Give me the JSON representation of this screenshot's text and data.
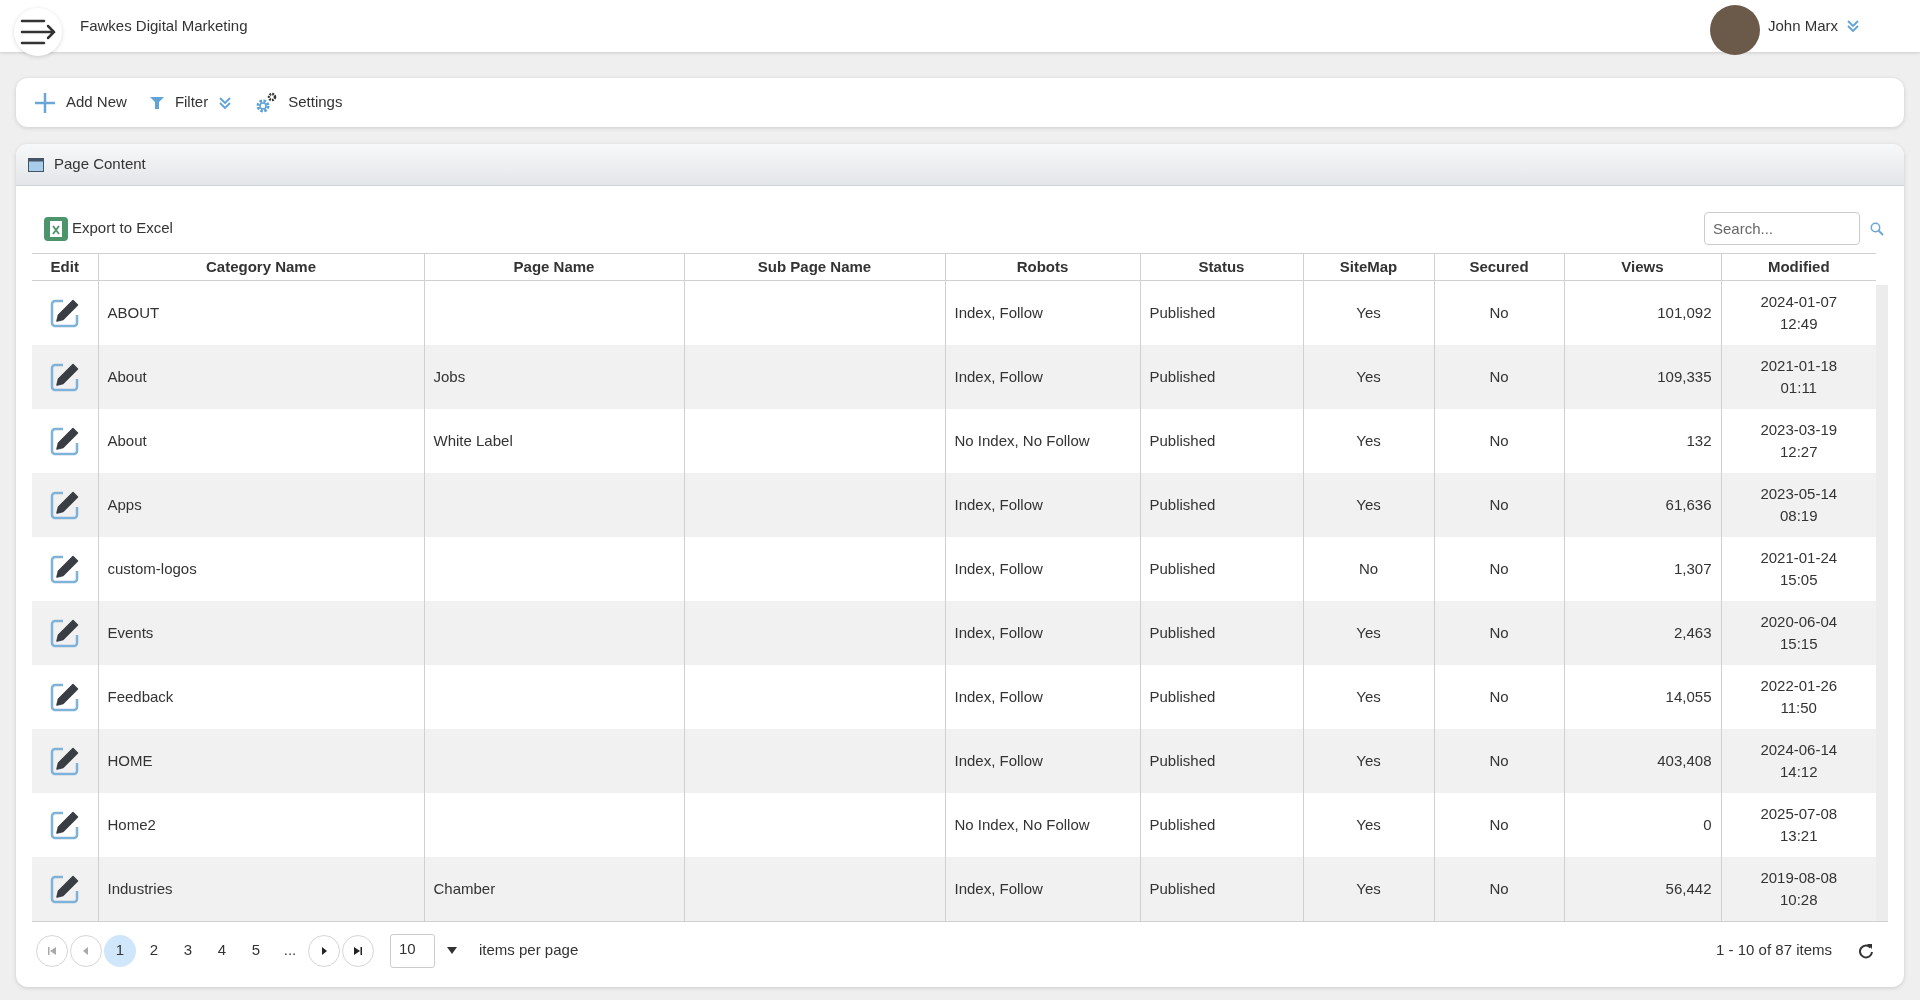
{
  "header": {
    "title": "Fawkes Digital Marketing",
    "user": "John Marx"
  },
  "toolbar": [
    {
      "kind": "add",
      "label": "Add New"
    },
    {
      "kind": "filter",
      "label": "Filter"
    },
    {
      "kind": "settings",
      "label": "Settings"
    }
  ],
  "panel": {
    "title": "Page Content",
    "export": "Export to Excel",
    "search": {
      "placeholder": "Search..."
    }
  },
  "table": {
    "columns": [
      "Edit",
      "Category Name",
      "Page Name",
      "Sub Page Name",
      "Robots",
      "Status",
      "SiteMap",
      "Secured",
      "Views",
      "Modified"
    ],
    "rows": [
      [
        "",
        "ABOUT",
        "",
        "",
        "Index, Follow",
        "Published",
        "Yes",
        "No",
        "101,092",
        "2024-01-07 12:49"
      ],
      [
        "",
        "About",
        "Jobs",
        "",
        "Index, Follow",
        "Published",
        "Yes",
        "No",
        "109,335",
        "2021-01-18 01:11"
      ],
      [
        "",
        "About",
        "White Label",
        "",
        "No Index, No Follow",
        "Published",
        "Yes",
        "No",
        "132",
        "2023-03-19 12:27"
      ],
      [
        "",
        "Apps",
        "",
        "",
        "Index, Follow",
        "Published",
        "Yes",
        "No",
        "61,636",
        "2023-05-14 08:19"
      ],
      [
        "",
        "custom-logos",
        "",
        "",
        "Index, Follow",
        "Published",
        "No",
        "No",
        "1,307",
        "2021-01-24 15:05"
      ],
      [
        "",
        "Events",
        "",
        "",
        "Index, Follow",
        "Published",
        "Yes",
        "No",
        "2,463",
        "2020-06-04 15:15"
      ],
      [
        "",
        "Feedback",
        "",
        "",
        "Index, Follow",
        "Published",
        "Yes",
        "No",
        "14,055",
        "2022-01-26 11:50"
      ],
      [
        "",
        "HOME",
        "",
        "",
        "Index, Follow",
        "Published",
        "Yes",
        "No",
        "403,408",
        "2024-06-14 14:12"
      ],
      [
        "",
        "Home2",
        "",
        "",
        "No Index, No Follow",
        "Published",
        "Yes",
        "No",
        "0",
        "2025-07-08 13:21"
      ],
      [
        "",
        "Industries",
        "Chamber",
        "",
        "Index, Follow",
        "Published",
        "Yes",
        "No",
        "56,442",
        "2019-08-08 10:28"
      ]
    ]
  },
  "pager": {
    "pages": [
      {
        "label": "1",
        "selected": true
      },
      {
        "label": "2",
        "selected": false
      },
      {
        "label": "3",
        "selected": false
      },
      {
        "label": "4",
        "selected": false
      },
      {
        "label": "5",
        "selected": false
      },
      {
        "label": "...",
        "selected": false
      }
    ],
    "page_size": "10",
    "page_size_label": "items per page",
    "summary": "1 - 10 of 87 items"
  }
}
